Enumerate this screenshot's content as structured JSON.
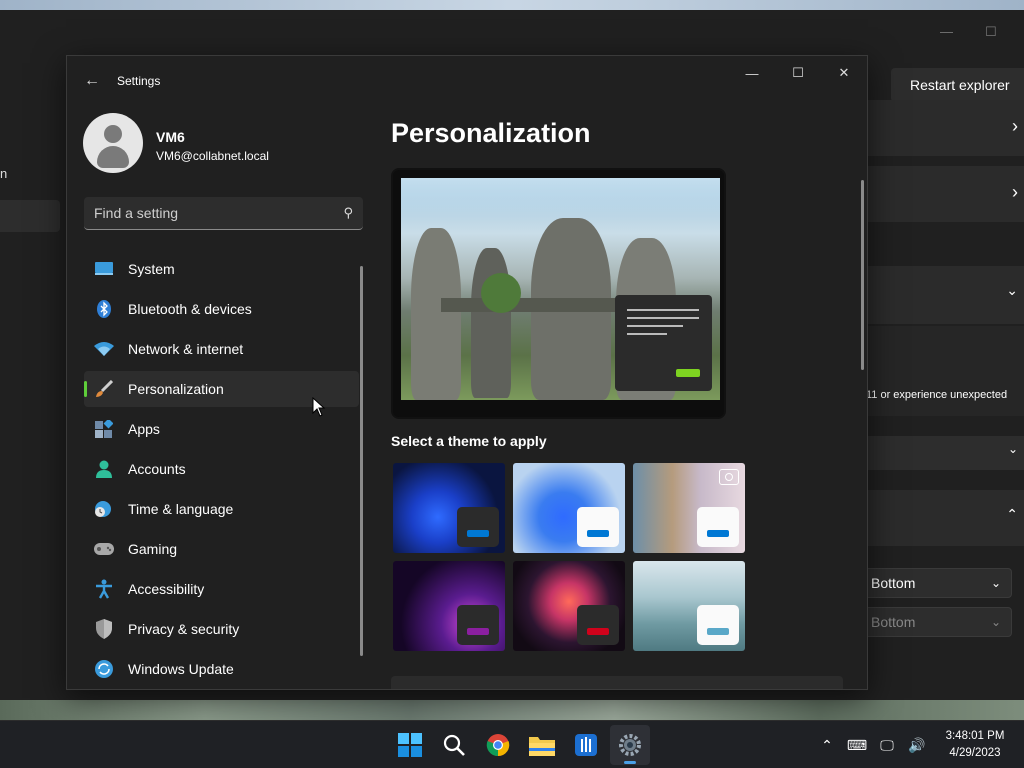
{
  "background": {
    "restart_button": "Restart explorer",
    "left_fragment": "n",
    "warning_text": "11 or experience unexpected",
    "select_1": "Bottom",
    "select_2": "Bottom"
  },
  "window": {
    "title": "Settings"
  },
  "user": {
    "name": "VM6",
    "email": "VM6@collabnet.local"
  },
  "search": {
    "placeholder": "Find a setting"
  },
  "nav": {
    "items": [
      {
        "label": "System",
        "icon": "system-icon"
      },
      {
        "label": "Bluetooth & devices",
        "icon": "bluetooth-icon"
      },
      {
        "label": "Network & internet",
        "icon": "wifi-icon"
      },
      {
        "label": "Personalization",
        "icon": "brush-icon",
        "selected": true
      },
      {
        "label": "Apps",
        "icon": "apps-icon"
      },
      {
        "label": "Accounts",
        "icon": "accounts-icon"
      },
      {
        "label": "Time & language",
        "icon": "time-language-icon"
      },
      {
        "label": "Gaming",
        "icon": "gamepad-icon"
      },
      {
        "label": "Accessibility",
        "icon": "accessibility-icon"
      },
      {
        "label": "Privacy & security",
        "icon": "shield-icon"
      },
      {
        "label": "Windows Update",
        "icon": "update-icon"
      }
    ]
  },
  "content": {
    "title": "Personalization",
    "theme_label": "Select a theme to apply",
    "themes": [
      {
        "name": "windows-dark",
        "accent": "#0078d4"
      },
      {
        "name": "windows-light",
        "accent": "#0078d4"
      },
      {
        "name": "spotlight",
        "accent": "#0078d4"
      },
      {
        "name": "glow",
        "accent": "#8b1fa0"
      },
      {
        "name": "captured-motion",
        "accent": "#d0021b"
      },
      {
        "name": "flow",
        "accent": "#5aa8c8"
      }
    ]
  },
  "taskbar": {
    "apps": [
      "start-icon",
      "search-icon",
      "chrome-icon",
      "file-explorer-icon",
      "app-icon",
      "settings-icon"
    ],
    "time": "3:48:01 PM",
    "date": "4/29/2023"
  },
  "colors": {
    "accent_green": "#5fce3a",
    "background": "#202020"
  }
}
